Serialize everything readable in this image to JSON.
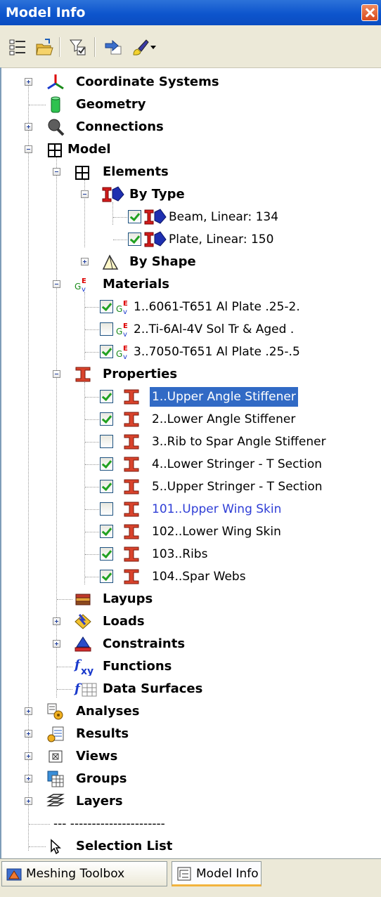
{
  "window": {
    "title": "Model Info"
  },
  "toolbar": {
    "icons": [
      "tree-list-icon",
      "open-folder-icon",
      "filter-check-icon",
      "export-arrow-icon",
      "paint-brush-icon",
      "dropdown-arrow-icon"
    ]
  },
  "tree": {
    "coordinate_systems": "Coordinate Systems",
    "geometry": "Geometry",
    "connections": "Connections",
    "model": "Model",
    "elements": "Elements",
    "by_type": "By Type",
    "beam": "Beam, Linear: 134",
    "plate": "Plate, Linear: 150",
    "by_shape": "By Shape",
    "materials": "Materials",
    "mat1": "1..6061-T651 Al Plate .25-2.",
    "mat2": "2..Ti-6Al-4V Sol Tr & Aged .",
    "mat3": "3..7050-T651 Al Plate .25-.5",
    "properties": "Properties",
    "prop1": "1..Upper Angle Stiffener",
    "prop2": "2..Lower Angle Stiffener",
    "prop3": "3..Rib to Spar Angle Stiffener",
    "prop4": "4..Lower Stringer - T Section",
    "prop5": "5..Upper Stringer - T Section",
    "prop101": "101..Upper Wing Skin",
    "prop102": "102..Lower Wing Skin",
    "prop103": "103..Ribs",
    "prop104": "104..Spar Webs",
    "layups": "Layups",
    "loads": "Loads",
    "constraints": "Constraints",
    "functions": "Functions",
    "data_surfaces": "Data Surfaces",
    "analyses": "Analyses",
    "results": "Results",
    "views": "Views",
    "groups": "Groups",
    "layers": "Layers",
    "separator": "---  ----------------------",
    "selection_list": "Selection List"
  },
  "tabs": {
    "meshing_toolbox": "Meshing Toolbox",
    "model_info": "Model Info"
  },
  "colors": {
    "titlebar": "#0d55cd",
    "selection": "#316ac5",
    "link_text": "#2f3ed6",
    "tab_highlight": "#f2b33d"
  }
}
